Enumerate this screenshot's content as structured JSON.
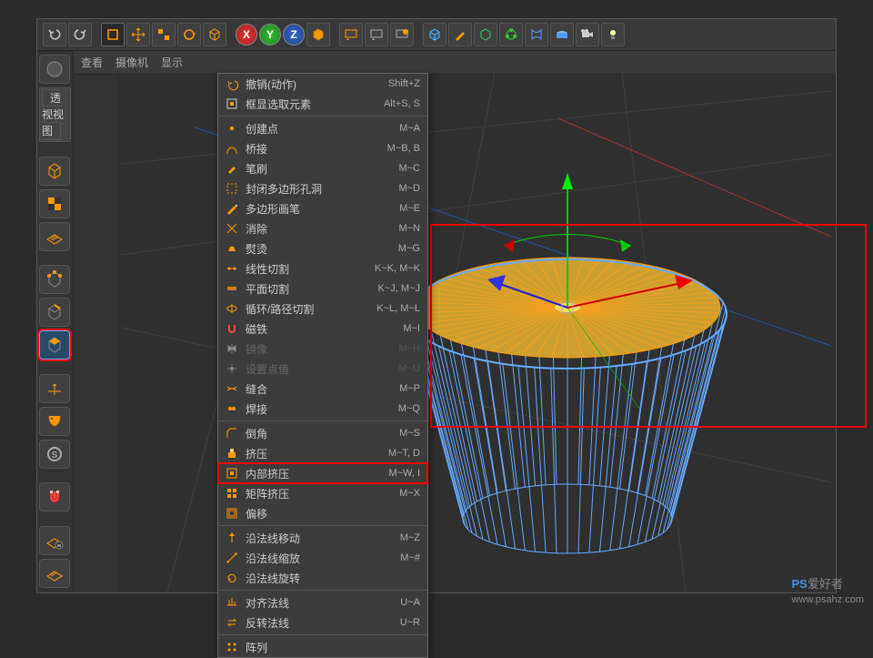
{
  "toolbar": {
    "undo": "↶",
    "redo": "↷",
    "axis_x": "X",
    "axis_y": "Y",
    "axis_z": "Z"
  },
  "view": {
    "label": "透视视图",
    "menus": [
      "查看",
      "摄像机",
      "显示"
    ]
  },
  "menu": {
    "sections": [
      [
        {
          "icon": "undo",
          "label": "撤销(动作)",
          "shortcut": "Shift+Z"
        },
        {
          "icon": "frame",
          "label": "框显选取元素",
          "shortcut": "Alt+S, S"
        }
      ],
      [
        {
          "icon": "point",
          "label": "创建点",
          "shortcut": "M~A"
        },
        {
          "icon": "bridge",
          "label": "桥接",
          "shortcut": "M~B, B"
        },
        {
          "icon": "brush",
          "label": "笔刷",
          "shortcut": "M~C"
        },
        {
          "icon": "close",
          "label": "封闭多边形孔洞",
          "shortcut": "M~D"
        },
        {
          "icon": "polypen",
          "label": "多边形画笔",
          "shortcut": "M~E"
        },
        {
          "icon": "dissolve",
          "label": "消除",
          "shortcut": "M~N"
        },
        {
          "icon": "iron",
          "label": "熨烫",
          "shortcut": "M~G"
        },
        {
          "icon": "linecut",
          "label": "线性切割",
          "shortcut": "K~K, M~K"
        },
        {
          "icon": "planecut",
          "label": "平面切割",
          "shortcut": "K~J, M~J"
        },
        {
          "icon": "loopcut",
          "label": "循环/路径切割",
          "shortcut": "K~L, M~L"
        },
        {
          "icon": "magnet",
          "label": "磁铁",
          "shortcut": "M~I"
        },
        {
          "icon": "mirror",
          "label": "镜像",
          "shortcut": "M~H",
          "disabled": true
        },
        {
          "icon": "setpt",
          "label": "设置点值",
          "shortcut": "M~U",
          "disabled": true
        },
        {
          "icon": "stitch",
          "label": "缝合",
          "shortcut": "M~P"
        },
        {
          "icon": "weld",
          "label": "焊接",
          "shortcut": "M~Q"
        }
      ],
      [
        {
          "icon": "bevel",
          "label": "倒角",
          "shortcut": "M~S"
        },
        {
          "icon": "extrude",
          "label": "挤压",
          "shortcut": "M~T, D"
        },
        {
          "icon": "innerext",
          "label": "内部挤压",
          "shortcut": "M~W, I",
          "highlight": true
        },
        {
          "icon": "matrixext",
          "label": "矩阵挤压",
          "shortcut": "M~X"
        },
        {
          "icon": "offset",
          "label": "偏移",
          "shortcut": ""
        }
      ],
      [
        {
          "icon": "nmove",
          "label": "沿法线移动",
          "shortcut": "M~Z"
        },
        {
          "icon": "nscale",
          "label": "沿法线缩放",
          "shortcut": "M~#"
        },
        {
          "icon": "nrotate",
          "label": "沿法线旋转",
          "shortcut": ""
        }
      ],
      [
        {
          "icon": "align",
          "label": "对齐法线",
          "shortcut": "U~A"
        },
        {
          "icon": "reverse",
          "label": "反转法线",
          "shortcut": "U~R"
        }
      ],
      [
        {
          "icon": "array",
          "label": "阵列",
          "shortcut": ""
        }
      ]
    ]
  },
  "axis_label_y": "Y",
  "watermark": {
    "brand": "PS",
    "text": "爱好者",
    "url": "www.psahz.com"
  }
}
